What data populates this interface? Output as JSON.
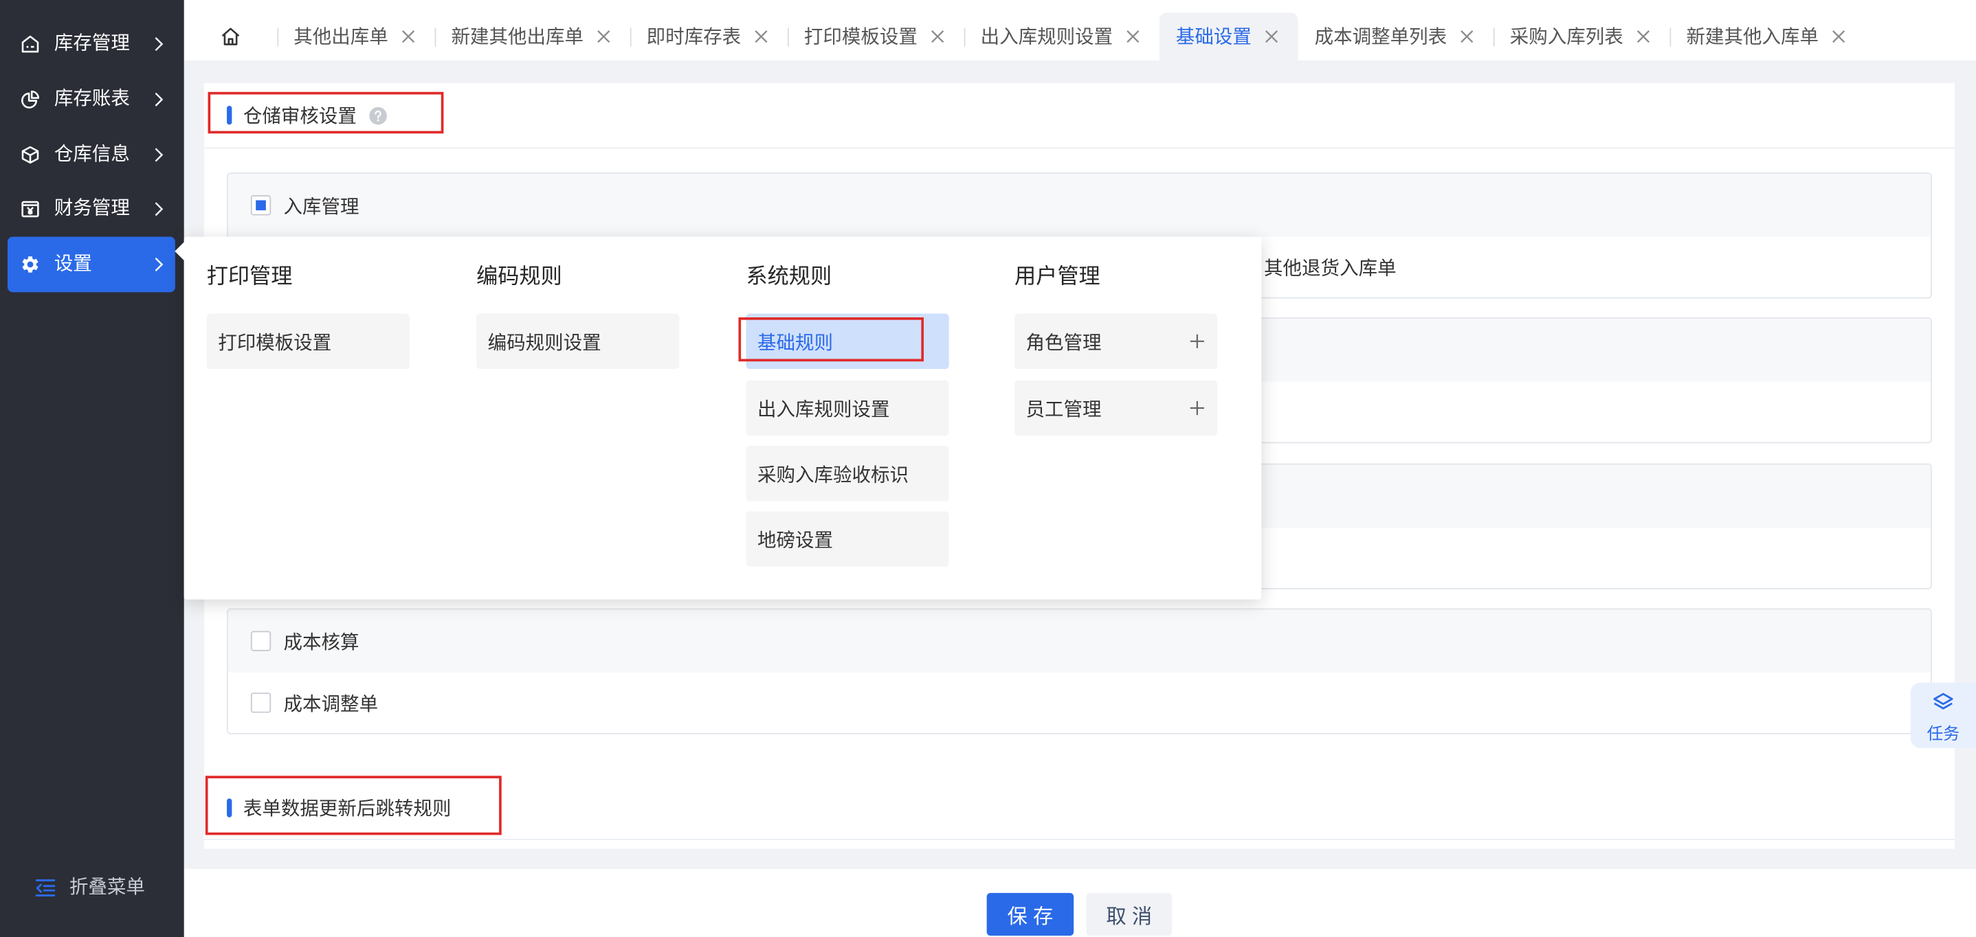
{
  "theme": {
    "accent": "#2a6ae8",
    "sidebar_background": "#2b2e37",
    "annotation_red": "#e02a2a",
    "menu_active_background": "#cfe0fc"
  },
  "sidebar": {
    "items": [
      {
        "label": "库存管理",
        "icon": "warehouse-icon"
      },
      {
        "label": "库存账表",
        "icon": "pie-chart-icon"
      },
      {
        "label": "仓库信息",
        "icon": "cube-icon"
      },
      {
        "label": "财务管理",
        "icon": "yen-box-icon"
      },
      {
        "label": "设置",
        "icon": "gear-icon",
        "active": true
      }
    ],
    "collapse": {
      "label": "折叠菜单",
      "icon": "menu-fold-icon"
    }
  },
  "tabs": {
    "home_icon": "home-icon",
    "close_icon": "close-icon",
    "items": [
      {
        "label": "其他出库单"
      },
      {
        "label": "新建其他出库单"
      },
      {
        "label": "即时库存表"
      },
      {
        "label": "打印模板设置"
      },
      {
        "label": "出入库规则设置"
      },
      {
        "label": "基础设置",
        "active": true
      },
      {
        "label": "成本调整单列表"
      },
      {
        "label": "采购入库列表"
      },
      {
        "label": "新建其他入库单"
      }
    ]
  },
  "settings_menu": {
    "columns": [
      {
        "title": "打印管理",
        "items": [
          {
            "label": "打印模板设置"
          }
        ]
      },
      {
        "title": "编码规则",
        "items": [
          {
            "label": "编码规则设置"
          }
        ]
      },
      {
        "title": "系统规则",
        "items": [
          {
            "label": "基础规则",
            "active": true
          },
          {
            "label": "出入库规则设置"
          },
          {
            "label": "采购入库验收标识"
          },
          {
            "label": "地磅设置"
          }
        ]
      },
      {
        "title": "用户管理",
        "items": [
          {
            "label": "角色管理",
            "expand_icon": "plus-icon"
          },
          {
            "label": "员工管理",
            "expand_icon": "plus-icon"
          }
        ]
      }
    ]
  },
  "audit_settings": {
    "title": "仓储审核设置",
    "help_icon": "question-circle-icon",
    "groups": [
      {
        "title": "入库管理",
        "indeterminate": true,
        "items": [
          {
            "label": "其他退货入库单"
          }
        ]
      },
      {
        "title": "成本核算",
        "checked": false,
        "items": [
          {
            "label": "成本调整单",
            "checked": false
          }
        ]
      }
    ]
  },
  "redirect_rules": {
    "title": "表单数据更新后跳转规则"
  },
  "footer": {
    "save_label": "保 存",
    "cancel_label": "取 消"
  },
  "task_float": {
    "label": "任务",
    "icon": "layers-icon"
  }
}
